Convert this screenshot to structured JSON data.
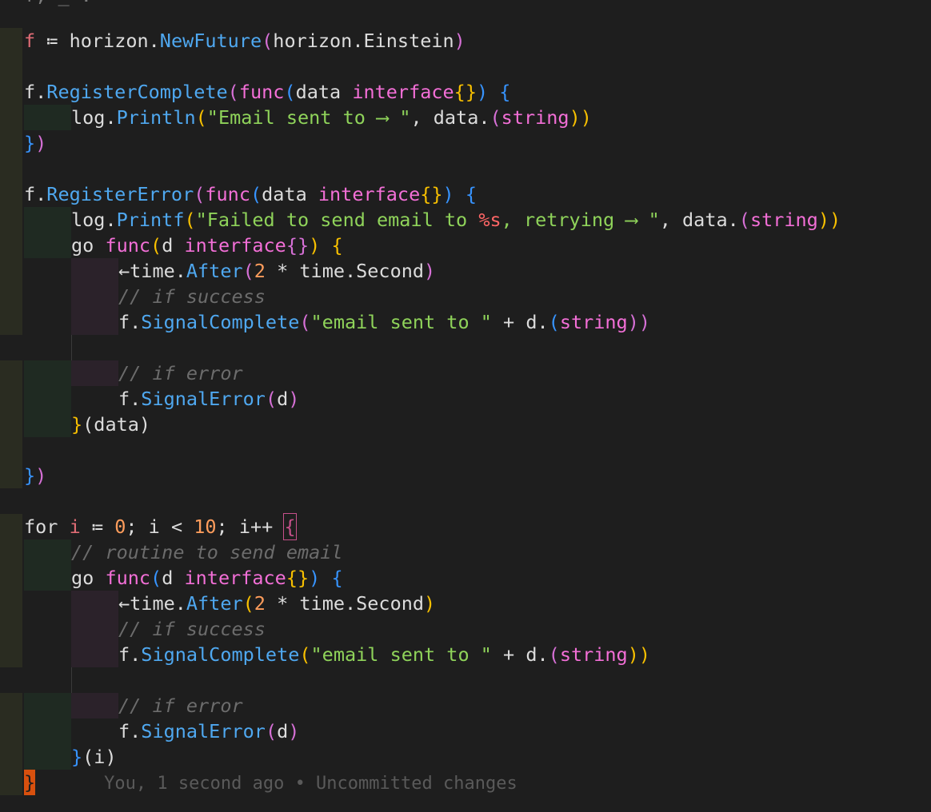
{
  "editor": {
    "top_partial": "f, _ :=",
    "lines": {
      "l1": {
        "a": "f",
        "b": " ≔ ",
        "c": "horizon.",
        "d": "NewFuture",
        "e": "(",
        "f": "horizon.Einstein",
        "g": ")"
      },
      "l3": {
        "a": "f.",
        "b": "RegisterComplete",
        "c": "(",
        "d": "func",
        "e": "(",
        "f": "data ",
        "g": "interface",
        "h": "{}",
        "i": ")",
        "j": " {"
      },
      "l4": {
        "a": "log.",
        "b": "Println",
        "c": "(",
        "d": "\"Email sent to ⟶ \"",
        "e": ", data.",
        "f": "(",
        "g": "string",
        "h": "))"
      },
      "l5": {
        "a": "}",
        "b": ")"
      },
      "l7": {
        "a": "f.",
        "b": "RegisterError",
        "c": "(",
        "d": "func",
        "e": "(",
        "f": "data ",
        "g": "interface",
        "h": "{}",
        "i": ")",
        "j": " {"
      },
      "l8": {
        "a": "log.",
        "b": "Printf",
        "c": "(",
        "d1": "\"Failed to send email to ",
        "d2": "%s",
        "d3": ", retrying ⟶ \"",
        "e": ", data.",
        "f": "(",
        "g": "string",
        "h": "))"
      },
      "l9": {
        "a": "go ",
        "b": "func",
        "c": "(",
        "d": "d ",
        "e": "interface",
        "f": "{}",
        "g": ")",
        "h": " {"
      },
      "l10": {
        "a": "←time.",
        "b": "After",
        "c": "(",
        "d": "2",
        "e": " * time.Second",
        "f": ")"
      },
      "l11": {
        "a": "// if success"
      },
      "l12": {
        "a": "f.",
        "b": "SignalComplete",
        "c": "(",
        "d": "\"email sent to \"",
        "e": " + d.",
        "f": "(",
        "g": "string",
        "h": "))"
      },
      "l14": {
        "a": "// if error"
      },
      "l15": {
        "a": "f.",
        "b": "SignalError",
        "c": "(",
        "d": "d",
        "e": ")"
      },
      "l16": {
        "a": "}",
        "b": "(data)"
      },
      "l18": {
        "a": "}",
        "b": ")"
      },
      "l20": {
        "a": "for ",
        "b": "i",
        "c": " ≔ ",
        "d": "0",
        "e": "; i < ",
        "f": "10",
        "g": "; i++ ",
        "h": "{"
      },
      "l21": {
        "a": "// routine to send email"
      },
      "l22": {
        "a": "go ",
        "b": "func",
        "c": "(",
        "d": "d ",
        "e": "interface",
        "f": "{}",
        "g": ")",
        "h": " {"
      },
      "l23": {
        "a": "←time.",
        "b": "After",
        "c": "(",
        "d": "2",
        "e": " * time.Second",
        "f": ")"
      },
      "l24": {
        "a": "// if success"
      },
      "l25": {
        "a": "f.",
        "b": "SignalComplete",
        "c": "(",
        "d": "\"email sent to \"",
        "e": " + d.",
        "f": "(",
        "g": "string",
        "h": "))"
      },
      "l27": {
        "a": "// if error"
      },
      "l28": {
        "a": "f.",
        "b": "SignalError",
        "c": "(",
        "d": "d",
        "e": ")"
      },
      "l29": {
        "a": "}",
        "b": "(i)"
      },
      "l30": {
        "a": "}",
        "blame": "You, 1 second ago • Uncommitted changes"
      }
    }
  }
}
